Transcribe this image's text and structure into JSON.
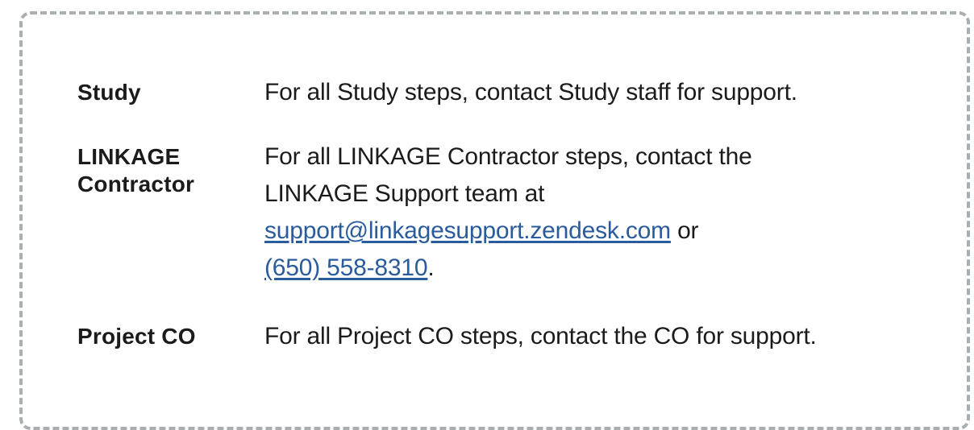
{
  "rows": [
    {
      "label": "Study",
      "text": "For all Study steps, contact Study staff for support."
    },
    {
      "label_line1": "LINKAGE",
      "label_line2": "Contractor",
      "text_line1": "For all LINKAGE Contractor steps, contact the",
      "text_line2": "LINKAGE Support team at",
      "email": "support@linkagesupport.zendesk.com",
      "or_text": " or",
      "phone": "(650) 558-8310",
      "period": "."
    },
    {
      "label": "Project CO",
      "text": "For all Project CO steps, contact the CO for support."
    }
  ]
}
